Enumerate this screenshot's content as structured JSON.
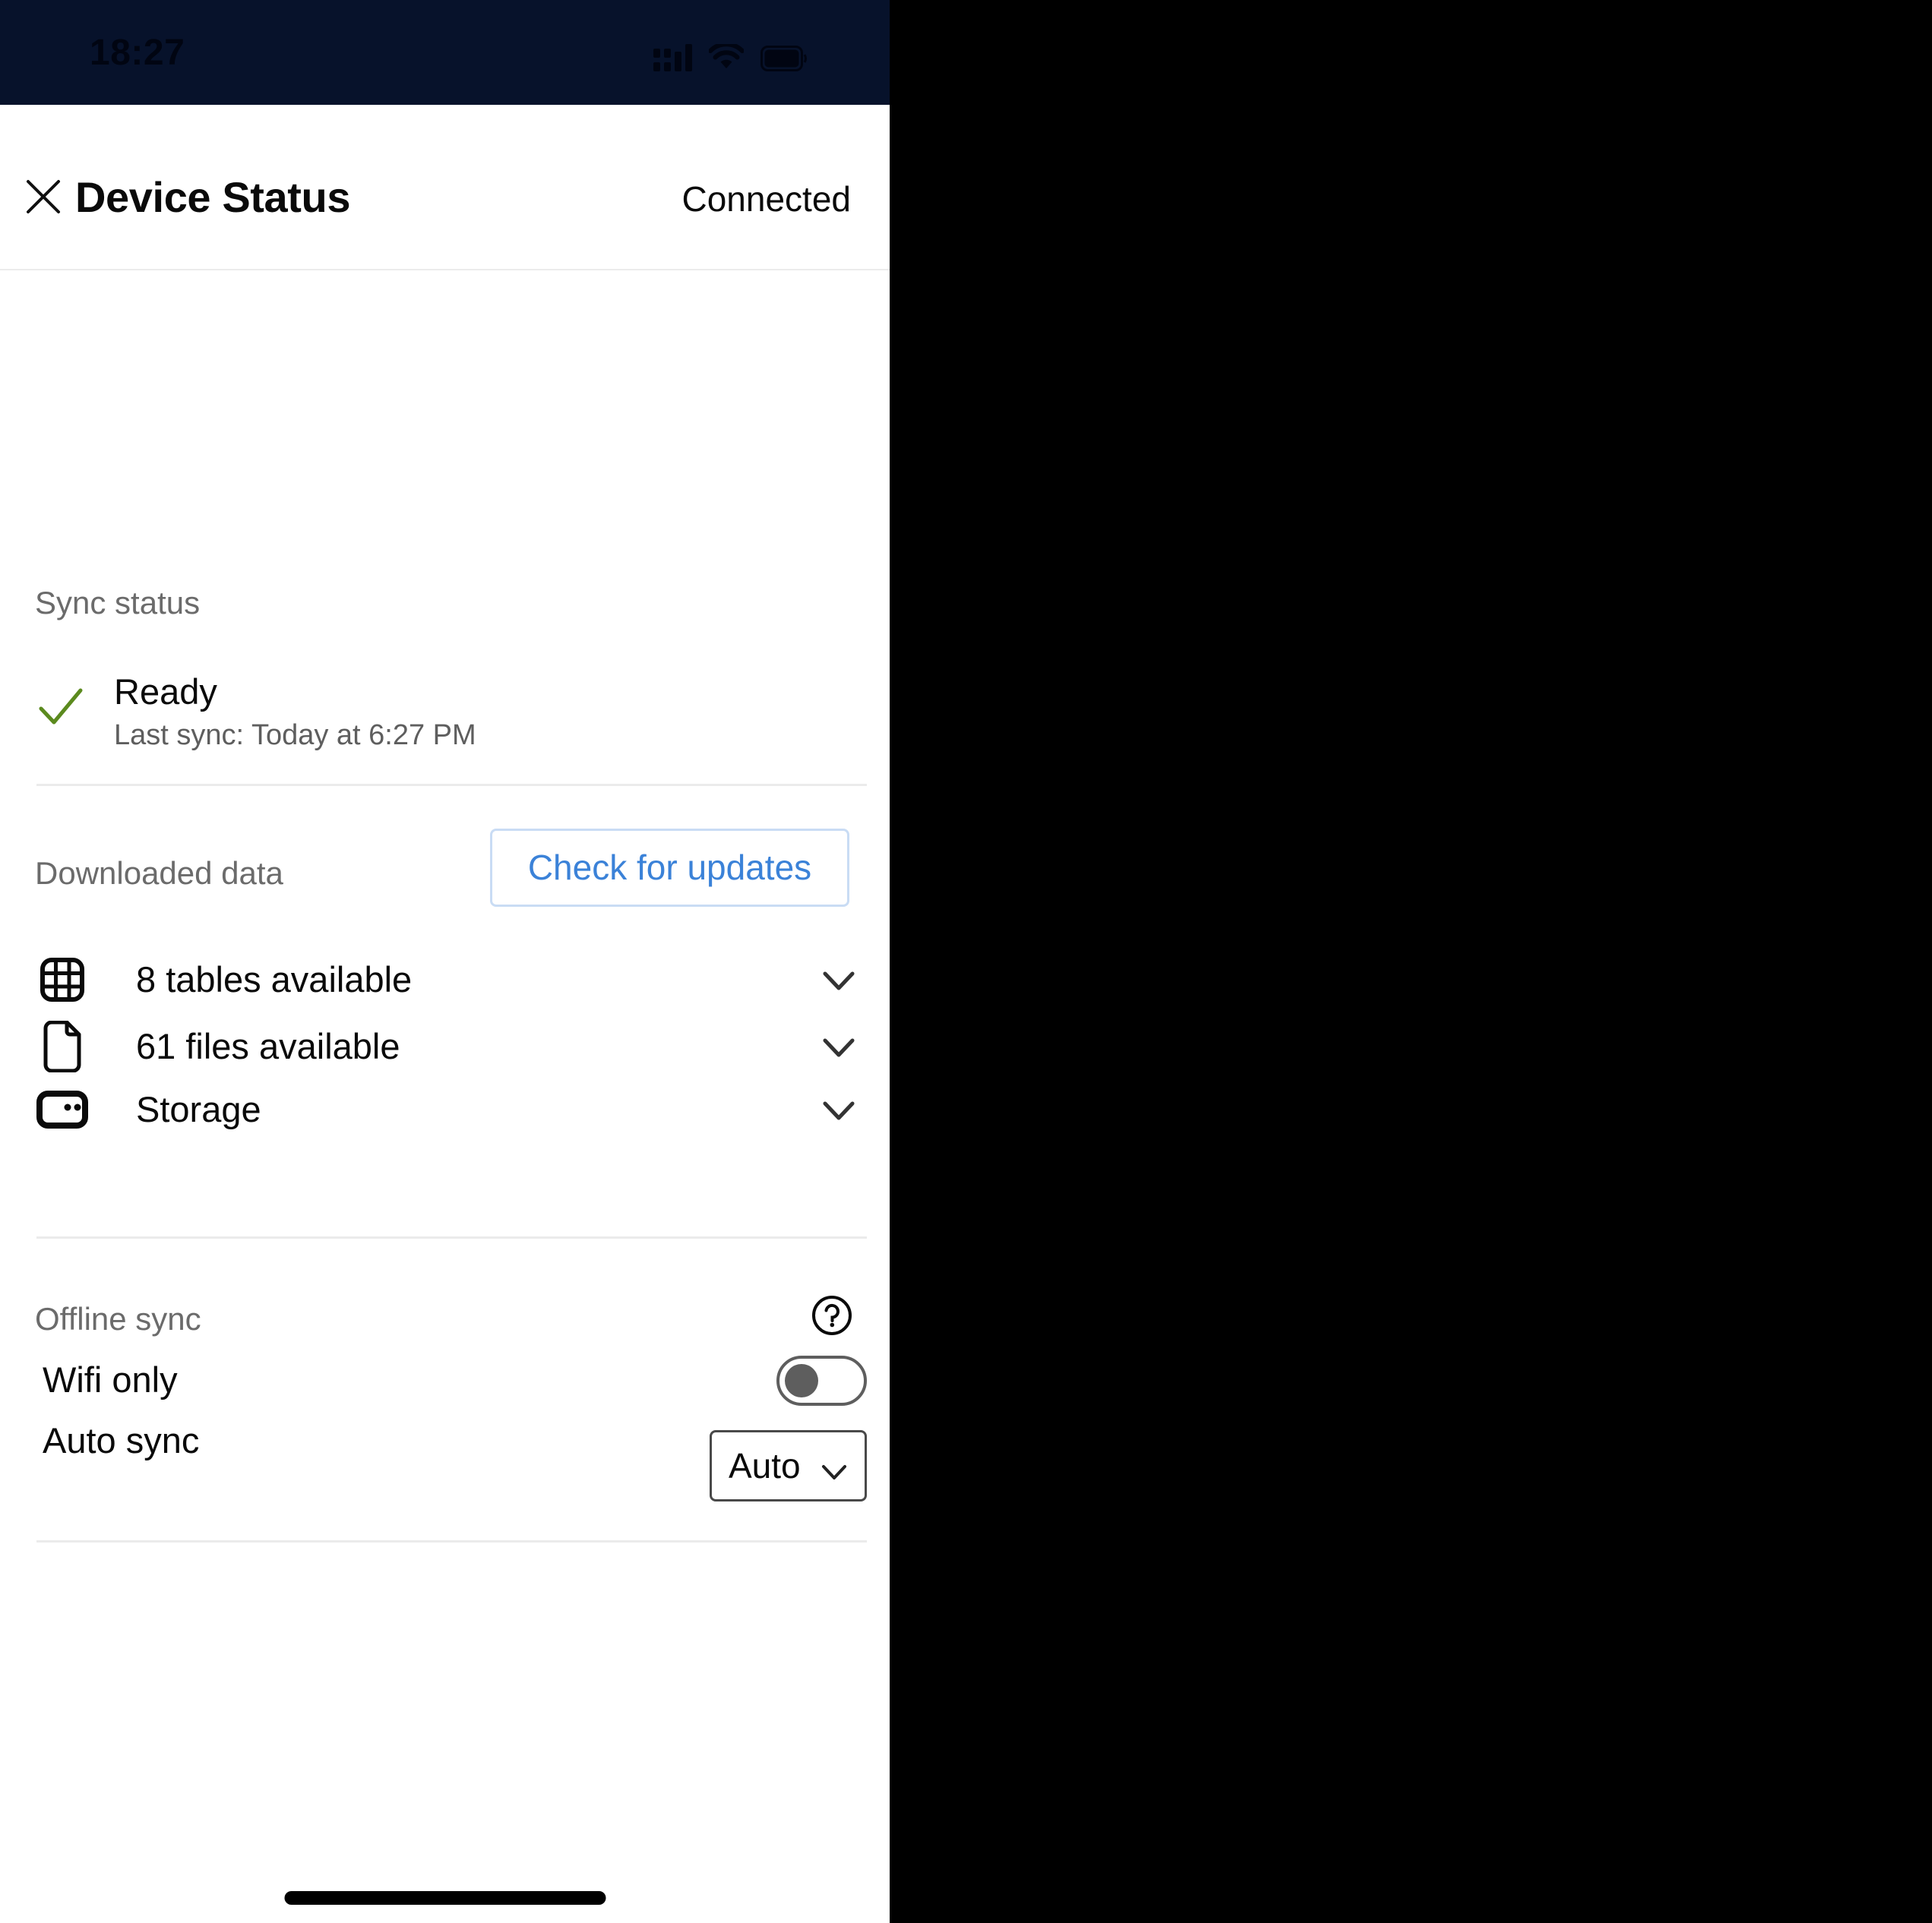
{
  "status_bar": {
    "time": "18:27",
    "background_color": "#07122b",
    "icons": [
      "cellular-signal-icon",
      "wifi-icon",
      "battery-icon"
    ]
  },
  "header": {
    "close_icon": "close-icon",
    "title": "Device Status",
    "connection_status": "Connected"
  },
  "sync_status": {
    "section_label": "Sync status",
    "status_icon": "check-icon",
    "status_icon_color": "#5b8a1e",
    "status_title": "Ready",
    "last_sync_text": "Last sync: Today at 6:27 PM"
  },
  "downloaded_data": {
    "section_label": "Downloaded data",
    "check_updates_label": "Check for updates",
    "check_updates_text_color": "#3b82d8",
    "check_updates_border_color": "#c9dcf4",
    "rows": [
      {
        "icon": "table-grid-icon",
        "label": "8 tables available",
        "chevron": "chevron-down-icon"
      },
      {
        "icon": "file-document-icon",
        "label": "61 files available",
        "chevron": "chevron-down-icon"
      },
      {
        "icon": "storage-drive-icon",
        "label": "Storage",
        "chevron": "chevron-down-icon"
      }
    ]
  },
  "offline_sync": {
    "section_label": "Offline sync",
    "help_icon": "help-circle-icon",
    "wifi_only": {
      "label": "Wifi only",
      "toggle_state": "off"
    },
    "auto_sync": {
      "label": "Auto sync",
      "selected_value": "Auto",
      "chevron": "chevron-down-icon"
    }
  }
}
